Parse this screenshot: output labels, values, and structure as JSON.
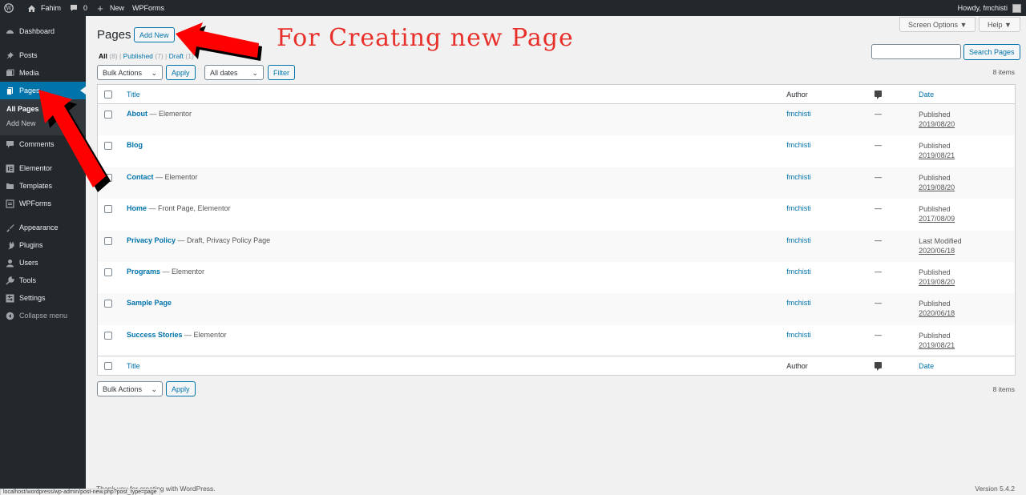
{
  "admin_bar": {
    "site_name": "Fahim",
    "comments_count": "0",
    "new_label": "New",
    "wpforms_label": "WPForms",
    "howdy": "Howdy, fmchisti"
  },
  "sidebar": {
    "items": [
      {
        "label": "Dashboard",
        "icon": "dashboard-icon"
      },
      {
        "label": "Posts",
        "icon": "pin-icon"
      },
      {
        "label": "Media",
        "icon": "media-icon"
      },
      {
        "label": "Pages",
        "icon": "pages-icon"
      },
      {
        "label": "Comments",
        "icon": "comment-icon"
      },
      {
        "label": "Elementor",
        "icon": "elementor-icon"
      },
      {
        "label": "Templates",
        "icon": "folder-icon"
      },
      {
        "label": "WPForms",
        "icon": "forms-icon"
      },
      {
        "label": "Appearance",
        "icon": "brush-icon"
      },
      {
        "label": "Plugins",
        "icon": "plugin-icon"
      },
      {
        "label": "Users",
        "icon": "user-icon"
      },
      {
        "label": "Tools",
        "icon": "wrench-icon"
      },
      {
        "label": "Settings",
        "icon": "settings-icon"
      },
      {
        "label": "Collapse menu",
        "icon": "collapse-icon"
      }
    ],
    "pages_submenu": {
      "all_pages": "All Pages",
      "add_new": "Add New"
    }
  },
  "header": {
    "title": "Pages",
    "add_new": "Add New",
    "screen_options": "Screen Options ▼",
    "help": "Help ▼",
    "search_button": "Search Pages",
    "search_placeholder": ""
  },
  "filters": {
    "all": "All",
    "all_count": "(8)",
    "published": "Published",
    "published_count": "(7)",
    "draft": "Draft",
    "draft_count": "(1)",
    "bulk_actions": "Bulk Actions",
    "apply": "Apply",
    "all_dates": "All dates",
    "filter": "Filter",
    "items_count": "8 items"
  },
  "table": {
    "columns": {
      "title": "Title",
      "author": "Author",
      "date": "Date"
    },
    "rows": [
      {
        "title": "About",
        "state": " — Elementor",
        "author": "fmchisti",
        "comments": "—",
        "status": "Published",
        "date": "2019/08/20"
      },
      {
        "title": "Blog",
        "state": "",
        "author": "fmchisti",
        "comments": "—",
        "status": "Published",
        "date": "2019/08/21"
      },
      {
        "title": "Contact",
        "state": " — Elementor",
        "author": "fmchisti",
        "comments": "—",
        "status": "Published",
        "date": "2019/08/20"
      },
      {
        "title": "Home",
        "state": " — Front Page, Elementor",
        "author": "fmchisti",
        "comments": "—",
        "status": "Published",
        "date": "2017/08/09"
      },
      {
        "title": "Privacy Policy",
        "state": " — Draft, Privacy Policy Page",
        "author": "fmchisti",
        "comments": "—",
        "status": "Last Modified",
        "date": "2020/06/18"
      },
      {
        "title": "Programs",
        "state": " — Elementor",
        "author": "fmchisti",
        "comments": "—",
        "status": "Published",
        "date": "2019/08/20"
      },
      {
        "title": "Sample Page",
        "state": "",
        "author": "fmchisti",
        "comments": "—",
        "status": "Published",
        "date": "2020/06/18"
      },
      {
        "title": "Success Stories",
        "state": " — Elementor",
        "author": "fmchisti",
        "comments": "—",
        "status": "Published",
        "date": "2019/08/21"
      }
    ]
  },
  "footer": {
    "thanks": "Thank you for creating with WordPress.",
    "version": "Version 5.4.2",
    "status_url": "localhost/wordpress/wp-admin/post-new.php?post_type=page"
  },
  "annotation": {
    "text": "For Creating new Page",
    "color": "#e8302a"
  },
  "colors": {
    "accent": "#0073aa",
    "sidebar": "#23282d",
    "annotation_red": "#ff0000"
  }
}
